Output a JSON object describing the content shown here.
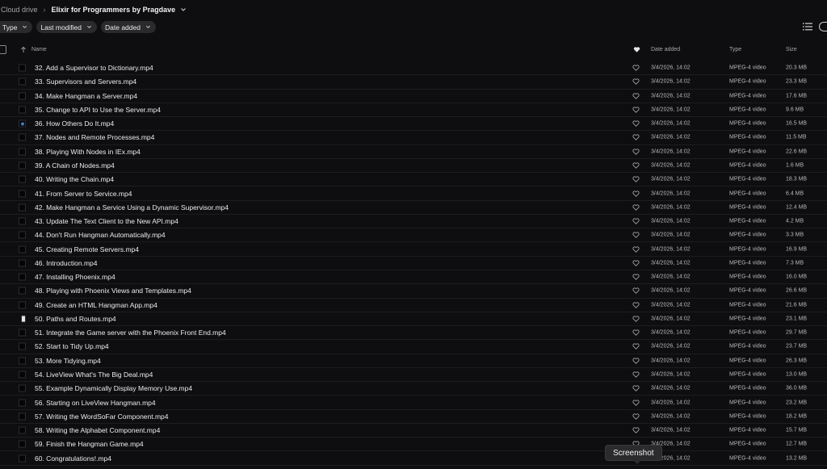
{
  "breadcrumb": {
    "root": "Cloud drive",
    "current": "Elixir for Programmers by Pragdave"
  },
  "filters": [
    {
      "label": "Type"
    },
    {
      "label": "Last modified"
    },
    {
      "label": "Date added"
    }
  ],
  "columns": {
    "name": "Name",
    "date_added": "Date added",
    "type": "Type",
    "size": "Size"
  },
  "tooltip": "Screenshot",
  "files": [
    {
      "name": "32. Add a Supervisor to Dictionary.mp4",
      "date": "3/4/2026, 14:02",
      "type": "MPEG-4 video",
      "size": "20.3 MB"
    },
    {
      "name": "33. Supervisors and Servers.mp4",
      "date": "3/4/2026, 14:02",
      "type": "MPEG-4 video",
      "size": "23.3 MB"
    },
    {
      "name": "34. Make Hangman a Server.mp4",
      "date": "3/4/2026, 14:02",
      "type": "MPEG-4 video",
      "size": "17.6 MB"
    },
    {
      "name": "35. Change to API to Use the Server.mp4",
      "date": "3/4/2026, 14:02",
      "type": "MPEG-4 video",
      "size": "9.6 MB"
    },
    {
      "name": "36. How Others Do It.mp4",
      "date": "3/4/2026, 14:02",
      "type": "MPEG-4 video",
      "size": "16.5 MB"
    },
    {
      "name": "37. Nodes and Remote Processes.mp4",
      "date": "3/4/2026, 14:02",
      "type": "MPEG-4 video",
      "size": "11.5 MB"
    },
    {
      "name": "38. Playing With Nodes in IEx.mp4",
      "date": "3/4/2026, 14:02",
      "type": "MPEG-4 video",
      "size": "22.6 MB"
    },
    {
      "name": "39. A Chain of Nodes.mp4",
      "date": "3/4/2026, 14:02",
      "type": "MPEG-4 video",
      "size": "1.6 MB"
    },
    {
      "name": "40. Writing the Chain.mp4",
      "date": "3/4/2026, 14:02",
      "type": "MPEG-4 video",
      "size": "18.3 MB"
    },
    {
      "name": "41. From Server to Service.mp4",
      "date": "3/4/2026, 14:02",
      "type": "MPEG-4 video",
      "size": "6.4 MB"
    },
    {
      "name": "42. Make Hangman a Service Using a Dynamic Supervisor.mp4",
      "date": "3/4/2026, 14:02",
      "type": "MPEG-4 video",
      "size": "12.4 MB"
    },
    {
      "name": "43. Update The Text Client to the New API.mp4",
      "date": "3/4/2026, 14:02",
      "type": "MPEG-4 video",
      "size": "4.2 MB"
    },
    {
      "name": "44. Don't Run Hangman Automatically.mp4",
      "date": "3/4/2026, 14:02",
      "type": "MPEG-4 video",
      "size": "3.3 MB"
    },
    {
      "name": "45. Creating Remote Servers.mp4",
      "date": "3/4/2026, 14:02",
      "type": "MPEG-4 video",
      "size": "16.9 MB"
    },
    {
      "name": "46. Introduction.mp4",
      "date": "3/4/2026, 14:02",
      "type": "MPEG-4 video",
      "size": "7.3 MB"
    },
    {
      "name": "47. Installing Phoenix.mp4",
      "date": "3/4/2026, 14:02",
      "type": "MPEG-4 video",
      "size": "16.0 MB"
    },
    {
      "name": "48. Playing with Phoenix Views and Templates.mp4",
      "date": "3/4/2026, 14:02",
      "type": "MPEG-4 video",
      "size": "26.6 MB"
    },
    {
      "name": "49. Create an HTML Hangman App.mp4",
      "date": "3/4/2026, 14:02",
      "type": "MPEG-4 video",
      "size": "21.6 MB"
    },
    {
      "name": "50. Paths and Routes.mp4",
      "date": "3/4/2026, 14:02",
      "type": "MPEG-4 video",
      "size": "23.1 MB"
    },
    {
      "name": "51. Integrate the Game server with the Phoenix Front End.mp4",
      "date": "3/4/2026, 14:02",
      "type": "MPEG-4 video",
      "size": "29.7 MB"
    },
    {
      "name": "52. Start to Tidy Up.mp4",
      "date": "3/4/2026, 14:02",
      "type": "MPEG-4 video",
      "size": "23.7 MB"
    },
    {
      "name": "53. More Tidying.mp4",
      "date": "3/4/2026, 14:02",
      "type": "MPEG-4 video",
      "size": "26.3 MB"
    },
    {
      "name": "54. LiveView What's The Big Deal.mp4",
      "date": "3/4/2026, 14:02",
      "type": "MPEG-4 video",
      "size": "13.0 MB"
    },
    {
      "name": "55. Example Dynamically Display Memory Use.mp4",
      "date": "3/4/2026, 14:02",
      "type": "MPEG-4 video",
      "size": "36.0 MB"
    },
    {
      "name": "56. Starting on LiveView Hangman.mp4",
      "date": "3/4/2026, 14:02",
      "type": "MPEG-4 video",
      "size": "23.2 MB"
    },
    {
      "name": "57. Writing the WordSoFar Component.mp4",
      "date": "3/4/2026, 14:02",
      "type": "MPEG-4 video",
      "size": "18.2 MB"
    },
    {
      "name": "58. Writing the Alphabet Component.mp4",
      "date": "3/4/2026, 14:02",
      "type": "MPEG-4 video",
      "size": "15.7 MB"
    },
    {
      "name": "59. Finish the Hangman Game.mp4",
      "date": "3/4/2026, 14:02",
      "type": "MPEG-4 video",
      "size": "12.7 MB"
    },
    {
      "name": "60. Congratulations!.mp4",
      "date": "3/4/2026, 14:02",
      "type": "MPEG-4 video",
      "size": "13.2 MB"
    }
  ],
  "icons": {
    "favorite": "heart-outline-icon",
    "sort": "arrow-up-icon",
    "view": "list-view-icon",
    "thumbnail": "video-thumbnail"
  },
  "colors": {
    "background": "#0e0e10",
    "chip": "#2a2a2d",
    "thumb_accent": "#3a78d8"
  }
}
